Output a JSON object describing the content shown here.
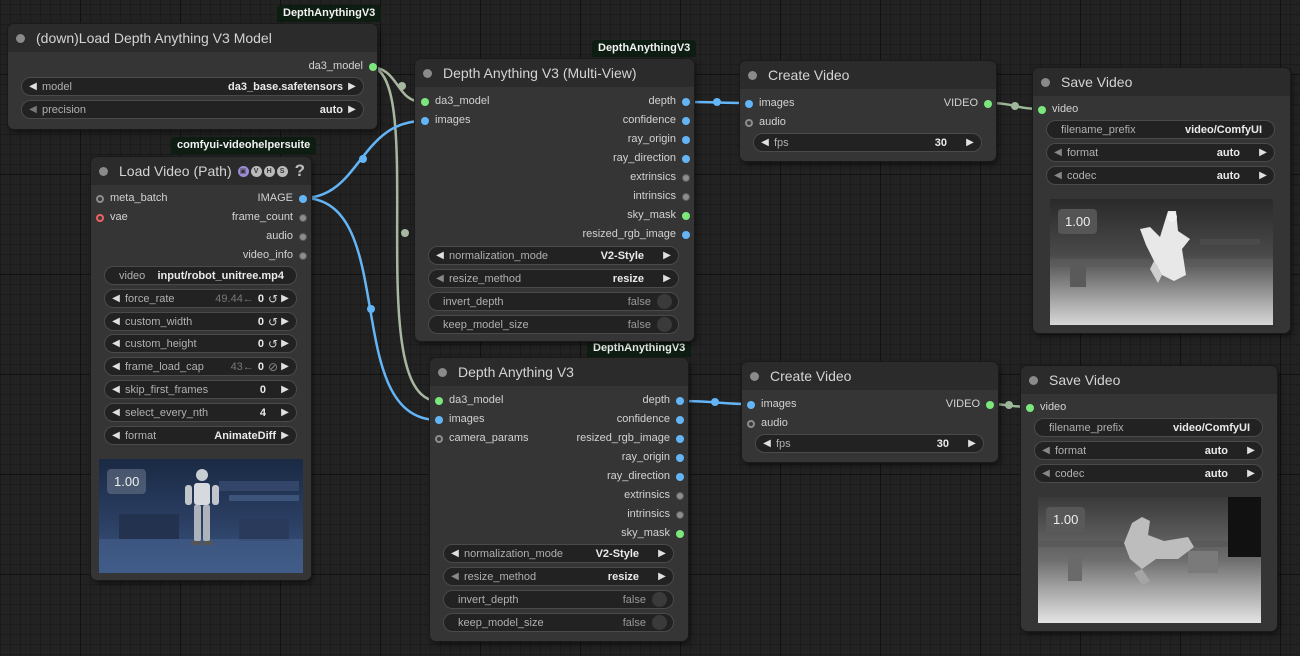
{
  "badges": {
    "loader": "DepthAnythingV3",
    "multiview": "DepthAnythingV3",
    "vhs": "comfyui-videohelpersuite",
    "single": "DepthAnythingV3"
  },
  "loader_node": {
    "title": "(down)Load Depth Anything V3 Model",
    "output": "da3_model",
    "model_label": "model",
    "model_value": "da3_base.safetensors",
    "precision_label": "precision",
    "precision_value": "auto"
  },
  "load_video": {
    "title": "Load Video (Path)",
    "help": "?",
    "inputs": [
      "meta_batch",
      "vae"
    ],
    "outputs": [
      "IMAGE",
      "frame_count",
      "audio",
      "video_info"
    ],
    "video_label": "video",
    "video_value": "input/robot_unitree.mp4",
    "widgets": [
      {
        "label": "force_rate",
        "ghost": "49.44←",
        "value": "0",
        "icon": "↺"
      },
      {
        "label": "custom_width",
        "ghost": "",
        "value": "0",
        "icon": "↺"
      },
      {
        "label": "custom_height",
        "ghost": "",
        "value": "0",
        "icon": "↺"
      },
      {
        "label": "frame_load_cap",
        "ghost": "43←",
        "value": "0",
        "icon": "⊘"
      },
      {
        "label": "skip_first_frames",
        "ghost": "",
        "value": "0",
        "icon": ""
      },
      {
        "label": "select_every_nth",
        "ghost": "",
        "value": "4",
        "icon": ""
      },
      {
        "label": "format",
        "ghost": "",
        "value": "AnimateDiff",
        "icon": ""
      }
    ],
    "preview_label": "1.00"
  },
  "multiview": {
    "title": "Depth Anything V3 (Multi-View)",
    "inputs": [
      "da3_model",
      "images"
    ],
    "outputs": [
      "depth",
      "confidence",
      "ray_origin",
      "ray_direction",
      "extrinsics",
      "intrinsics",
      "sky_mask",
      "resized_rgb_image"
    ],
    "normalization_label": "normalization_mode",
    "normalization_value": "V2-Style",
    "resize_label": "resize_method",
    "resize_value": "resize",
    "invert_label": "invert_depth",
    "invert_value": "false",
    "keep_label": "keep_model_size",
    "keep_value": "false"
  },
  "single": {
    "title": "Depth Anything V3",
    "inputs": [
      "da3_model",
      "images",
      "camera_params"
    ],
    "outputs": [
      "depth",
      "confidence",
      "resized_rgb_image",
      "ray_origin",
      "ray_direction",
      "extrinsics",
      "intrinsics",
      "sky_mask"
    ],
    "normalization_label": "normalization_mode",
    "normalization_value": "V2-Style",
    "resize_label": "resize_method",
    "resize_value": "resize",
    "invert_label": "invert_depth",
    "invert_value": "false",
    "keep_label": "keep_model_size",
    "keep_value": "false"
  },
  "create_video_top": {
    "title": "Create Video",
    "inputs": [
      "images",
      "audio"
    ],
    "output": "VIDEO",
    "fps_label": "fps",
    "fps_value": "30"
  },
  "create_video_bottom": {
    "title": "Create Video",
    "inputs": [
      "images",
      "audio"
    ],
    "output": "VIDEO",
    "fps_label": "fps",
    "fps_value": "30"
  },
  "save_video_top": {
    "title": "Save Video",
    "input": "video",
    "prefix_label": "filename_prefix",
    "prefix_value": "video/ComfyUI",
    "format_label": "format",
    "format_value": "auto",
    "codec_label": "codec",
    "codec_value": "auto",
    "preview_label": "1.00"
  },
  "save_video_bottom": {
    "title": "Save Video",
    "input": "video",
    "prefix_label": "filename_prefix",
    "prefix_value": "video/ComfyUI",
    "format_label": "format",
    "format_value": "auto",
    "codec_label": "codec",
    "codec_value": "auto",
    "preview_label": "1.00"
  },
  "colors": {
    "canvas": "#222222",
    "node_body": "#353535",
    "node_title": "#2b2b2b",
    "badge_bg": "#0d1d12",
    "wire_model": "#a8b8a0",
    "wire_image": "#64b5f6",
    "wire_video": "#9eb79a"
  }
}
